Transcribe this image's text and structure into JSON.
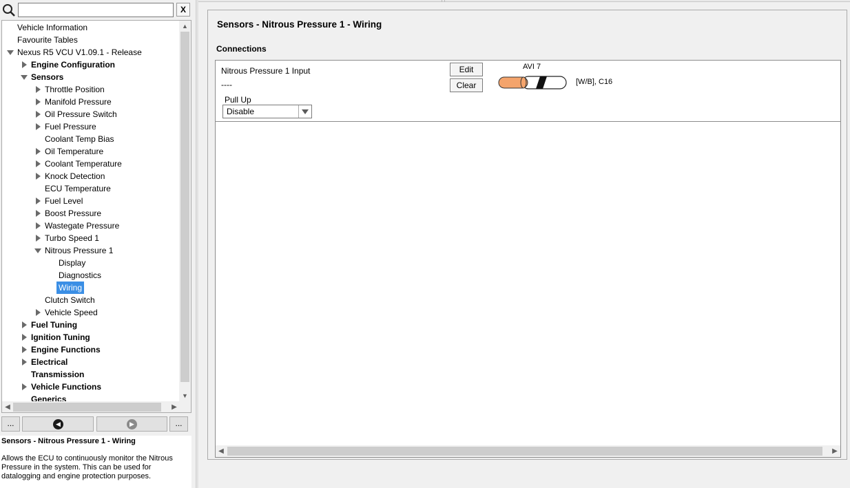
{
  "search": {
    "placeholder": "",
    "value": "",
    "clear_label": "X"
  },
  "tree": {
    "items": [
      {
        "label": "Vehicle Information",
        "bold": false,
        "arrow": "none",
        "selected": false
      },
      {
        "label": "Favourite Tables",
        "bold": false,
        "arrow": "none",
        "selected": false
      },
      {
        "label": "Nexus R5 VCU V1.09.1 - Release",
        "bold": false,
        "arrow": "down",
        "selected": false
      },
      {
        "label": "Engine Configuration",
        "bold": true,
        "arrow": "right",
        "selected": false
      },
      {
        "label": "Sensors",
        "bold": true,
        "arrow": "down",
        "selected": false
      },
      {
        "label": "Throttle Position",
        "bold": false,
        "arrow": "right",
        "selected": false
      },
      {
        "label": "Manifold Pressure",
        "bold": false,
        "arrow": "right",
        "selected": false
      },
      {
        "label": "Oil Pressure Switch",
        "bold": false,
        "arrow": "right",
        "selected": false
      },
      {
        "label": "Fuel Pressure",
        "bold": false,
        "arrow": "right",
        "selected": false
      },
      {
        "label": "Coolant Temp Bias",
        "bold": false,
        "arrow": "none",
        "selected": false
      },
      {
        "label": "Oil Temperature",
        "bold": false,
        "arrow": "right",
        "selected": false
      },
      {
        "label": "Coolant Temperature",
        "bold": false,
        "arrow": "right",
        "selected": false
      },
      {
        "label": "Knock Detection",
        "bold": false,
        "arrow": "right",
        "selected": false
      },
      {
        "label": "ECU Temperature",
        "bold": false,
        "arrow": "none",
        "selected": false
      },
      {
        "label": "Fuel Level",
        "bold": false,
        "arrow": "right",
        "selected": false
      },
      {
        "label": "Boost Pressure",
        "bold": false,
        "arrow": "right",
        "selected": false
      },
      {
        "label": "Wastegate Pressure",
        "bold": false,
        "arrow": "right",
        "selected": false
      },
      {
        "label": "Turbo Speed 1",
        "bold": false,
        "arrow": "right",
        "selected": false
      },
      {
        "label": "Nitrous Pressure 1",
        "bold": false,
        "arrow": "down",
        "selected": false
      },
      {
        "label": "Display",
        "bold": false,
        "arrow": "none",
        "selected": false
      },
      {
        "label": "Diagnostics",
        "bold": false,
        "arrow": "none",
        "selected": false
      },
      {
        "label": "Wiring",
        "bold": false,
        "arrow": "none",
        "selected": true
      },
      {
        "label": "Clutch Switch",
        "bold": false,
        "arrow": "none",
        "selected": false
      },
      {
        "label": "Vehicle Speed",
        "bold": false,
        "arrow": "right",
        "selected": false
      },
      {
        "label": "Fuel Tuning",
        "bold": true,
        "arrow": "right",
        "selected": false
      },
      {
        "label": "Ignition Tuning",
        "bold": true,
        "arrow": "right",
        "selected": false
      },
      {
        "label": "Engine Functions",
        "bold": true,
        "arrow": "right",
        "selected": false
      },
      {
        "label": "Electrical",
        "bold": true,
        "arrow": "right",
        "selected": false
      },
      {
        "label": "Transmission",
        "bold": true,
        "arrow": "none",
        "selected": false
      },
      {
        "label": "Vehicle Functions",
        "bold": true,
        "arrow": "right",
        "selected": false
      },
      {
        "label": "Generics",
        "bold": true,
        "arrow": "none",
        "selected": false
      }
    ]
  },
  "nav": {
    "more_left": "...",
    "more_right": "...",
    "back_icon": "back-arrow-icon",
    "forward_icon": "forward-arrow-icon"
  },
  "help": {
    "title": "Sensors - Nitrous Pressure 1 - Wiring",
    "text": "Allows the ECU to continuously monitor the Nitrous Pressure in the system. This can be used for datalogging and engine protection purposes."
  },
  "main": {
    "title": "Sensors - Nitrous Pressure 1 - Wiring",
    "section": "Connections",
    "input_label": "Nitrous Pressure 1 Input",
    "input_value": "----",
    "edit_label": "Edit",
    "clear_label": "Clear",
    "pullup_label": "Pull Up",
    "pullup_value": "Disable",
    "wire_name": "AVI 7",
    "wire_code": "[W/B], C16"
  },
  "colors": {
    "selection": "#3b8fe5",
    "wire_core": "#f4a46c"
  }
}
